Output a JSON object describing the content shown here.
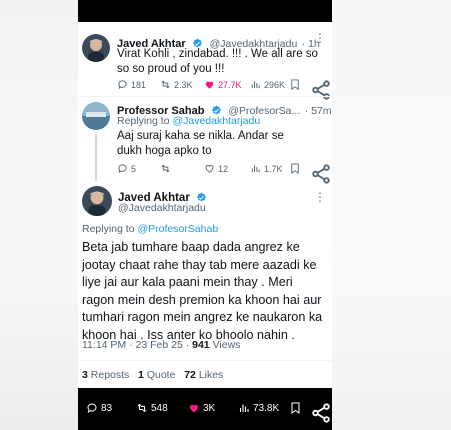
{
  "tweets": [
    {
      "author": "Javed Akhtar",
      "handle": "@Javedakhtarjadu",
      "time": "· 1h",
      "text": "Virat Kohli , zindabad. !!! . We all are so so so proud of you !!!",
      "replies": "181",
      "retweets": "2.3K",
      "likes": "27.7K",
      "views": "296K"
    },
    {
      "author": "Professor Sahab",
      "handle": "@ProfesorSa...",
      "time": "· 57m",
      "replying_to_prefix": "Replying to",
      "replying_to": "@Javedakhtarjadu",
      "text": "Aaj suraj kaha se nikla. Andar se dukh hoga apko to",
      "replies": "5",
      "retweets": "",
      "likes": "12",
      "views": "1.7K"
    }
  ],
  "main_tweet": {
    "author": "Javed Akhtar",
    "handle": "@Javedakhtarjadu",
    "replying_to_prefix": "Replying to",
    "replying_to": "@ProfesorSahab",
    "text": "Beta jab tumhare baap dada angrez ke jootay chaat rahe thay tab mere aazadi ke liye jai aur kala paani mein thay . Meri ragon mein desh premion ka khoon hai aur tumhari ragon mein angrez ke naukaron ka khoon hai . Iss anter ko bhoolo nahin .",
    "timestamp": "11:14 PM · 23 Feb 25 ·",
    "views_count": "941",
    "views_label": "Views",
    "reposts_count": "3",
    "reposts_label": "Reposts",
    "quotes_count": "1",
    "quotes_label": "Quote",
    "likes_count": "72",
    "likes_label": "Likes"
  },
  "bottom_bar": {
    "replies": "83",
    "retweets": "548",
    "likes": "3K",
    "views": "73.8K"
  },
  "colors": {
    "accent": "#1d9bf0",
    "like": "#f91880",
    "muted": "#536471"
  }
}
